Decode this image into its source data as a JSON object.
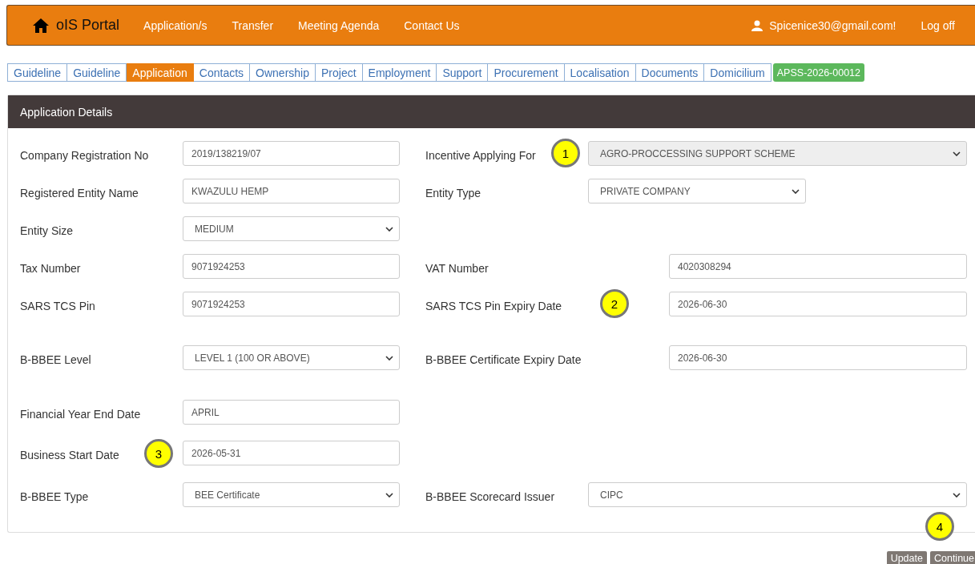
{
  "navbar": {
    "brand": "oIS Portal",
    "links": [
      "Application/s",
      "Transfer",
      "Meeting Agenda",
      "Contact Us"
    ],
    "user": "Spicenice30@gmail.com!",
    "logoff": "Log off"
  },
  "tabs": [
    {
      "label": "Guideline",
      "selected": false
    },
    {
      "label": "Guideline",
      "selected": false
    },
    {
      "label": "Application",
      "selected": true
    },
    {
      "label": "Contacts",
      "selected": false
    },
    {
      "label": "Ownership",
      "selected": false
    },
    {
      "label": "Project",
      "selected": false
    },
    {
      "label": "Employment",
      "selected": false
    },
    {
      "label": "Support",
      "selected": false
    },
    {
      "label": "Procurement",
      "selected": false
    },
    {
      "label": "Localisation",
      "selected": false
    },
    {
      "label": "Documents",
      "selected": false
    },
    {
      "label": "Domicilium",
      "selected": false
    }
  ],
  "application_id": "APSS-2026-00012",
  "panel": {
    "title": "Application Details",
    "rows": [
      {
        "left": {
          "label": "Company Registration No",
          "kind": "text",
          "value": "2019/138219/07",
          "disabled": false
        },
        "right": {
          "label": "Incentive Applying For",
          "kind": "select",
          "value": "AGRO-PROCCESSING SUPPORT SCHEME",
          "disabled": true,
          "annotation": "1"
        }
      },
      {
        "left": {
          "label": "Registered Entity Name",
          "kind": "text",
          "value": "KWAZULU HEMP",
          "disabled": false
        },
        "right": {
          "label": "Entity Type",
          "kind": "select",
          "value": "PRIVATE COMPANY",
          "disabled": false
        }
      },
      {
        "left": {
          "label": "Entity Size",
          "kind": "select",
          "value": "MEDIUM",
          "disabled": false
        }
      },
      {
        "left": {
          "label": "Tax Number",
          "kind": "text",
          "value": "9071924253",
          "disabled": false
        },
        "right": {
          "label": "VAT Number",
          "kind": "text",
          "value": "4020308294",
          "disabled": false
        }
      },
      {
        "left": {
          "label": "SARS TCS Pin",
          "kind": "text",
          "value": "9071924253",
          "disabled": false
        },
        "right": {
          "label": "SARS TCS Pin Expiry Date",
          "kind": "text",
          "value": "2026-06-30",
          "disabled": false,
          "annotation": "2"
        }
      },
      {
        "left": {
          "label": "B-BBEE Level",
          "kind": "select",
          "value": "LEVEL 1 (100 OR ABOVE)",
          "disabled": false
        },
        "right": {
          "label": "B-BBEE Certificate Expiry Date",
          "kind": "text",
          "value": "2026-06-30",
          "disabled": false
        }
      },
      {
        "left": {
          "label": "Financial Year End Date",
          "kind": "text",
          "value": "APRIL",
          "disabled": false
        }
      },
      {
        "left": {
          "label": "Business Start Date",
          "kind": "text",
          "value": "2026-05-31",
          "disabled": false,
          "annotation": "3"
        }
      },
      {
        "left": {
          "label": "B-BBEE Type",
          "kind": "select",
          "value": "BEE Certificate",
          "disabled": false
        },
        "right": {
          "label": "B-BBEE Scorecard Issuer",
          "kind": "select",
          "value": "CIPC",
          "disabled": false
        }
      }
    ]
  },
  "buttons_annotation": "4",
  "buttons": [
    "Update",
    "Continue"
  ]
}
